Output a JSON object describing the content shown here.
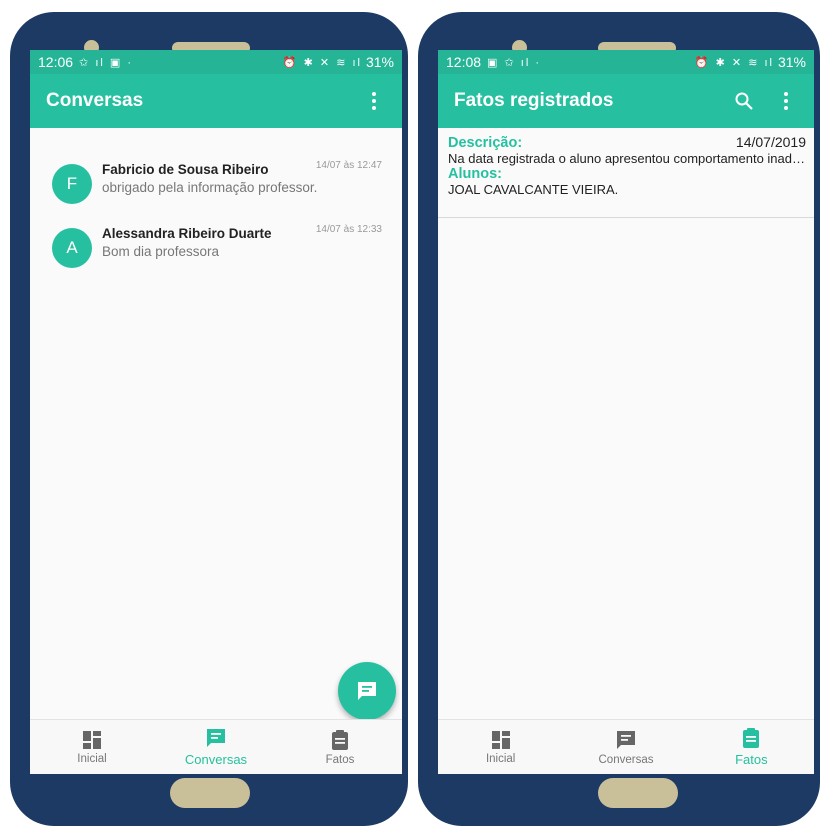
{
  "left_screen": {
    "status": {
      "time": "12:06",
      "icons_left": "✩ ıl ▣ ·",
      "icons_right": "⏰ ✱ ✕ ≋ ıl",
      "battery": "31%"
    },
    "appbar": {
      "title": "Conversas"
    },
    "conversations": [
      {
        "initial": "F",
        "name": "Fabricio  de Sousa Ribeiro",
        "message": "obrigado pela informação professor.",
        "time": "14/07 às 12:47"
      },
      {
        "initial": "A",
        "name": "Alessandra Ribeiro Duarte",
        "message": "Bom dia professora",
        "time": "14/07 às 12:33"
      }
    ],
    "nav": {
      "inicial": "Inicial",
      "conversas": "Conversas",
      "fatos": "Fatos"
    }
  },
  "right_screen": {
    "status": {
      "time": "12:08",
      "icons_left": "▣ ✩ ıl ·",
      "icons_right": "⏰ ✱ ✕ ≋ ıl",
      "battery": "31%"
    },
    "appbar": {
      "title": "Fatos registrados"
    },
    "fato": {
      "descricao_label": "Descrição:",
      "date": "14/07/2019",
      "descricao_text": "Na data registrada o aluno apresentou comportamento inadequado",
      "alunos_label": "Alunos:",
      "alunos_text": "JOAL CAVALCANTE VIEIRA."
    },
    "nav": {
      "inicial": "Inicial",
      "conversas": "Conversas",
      "fatos": "Fatos"
    }
  },
  "colors": {
    "accent": "#26c0a0",
    "phone_frame": "#1c3a63",
    "hardware": "#c9c09a"
  }
}
